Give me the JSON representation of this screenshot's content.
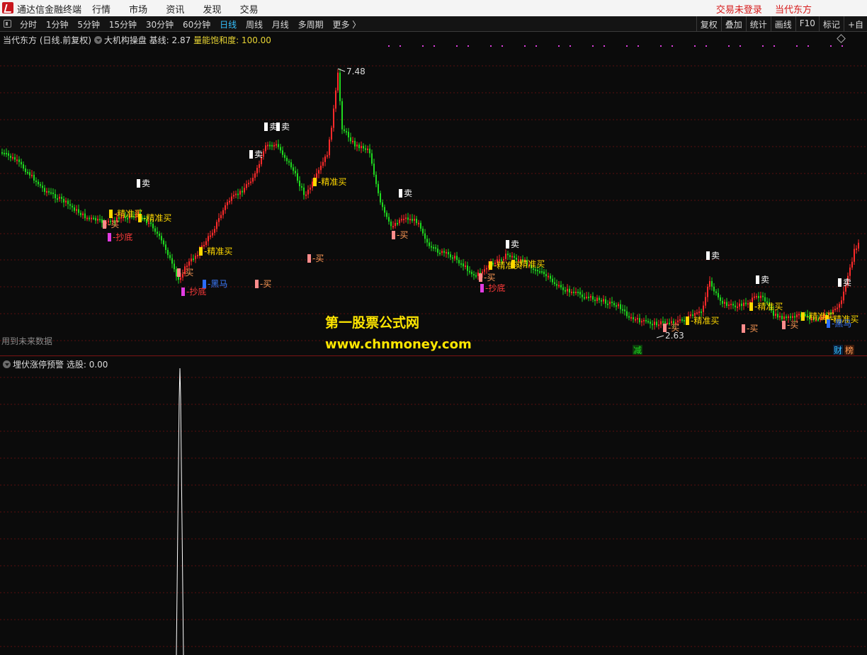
{
  "titlebar": {
    "app_title": "通达信金融终端",
    "menu": [
      "行情",
      "市场",
      "资讯",
      "发现",
      "交易"
    ],
    "trade_status": "交易未登录",
    "stock_name": "当代东方"
  },
  "toolbar": {
    "periods": [
      "分时",
      "1分钟",
      "5分钟",
      "15分钟",
      "30分钟",
      "60分钟",
      "日线",
      "周线",
      "月线",
      "多周期",
      "更多 〉"
    ],
    "active_period": "日线",
    "tools": [
      "复权",
      "叠加",
      "统计",
      "画线",
      "F10",
      "标记",
      "+自"
    ]
  },
  "main_panel": {
    "title": "当代东方 (日线.前复权)",
    "indicator_name": "大机构操盘",
    "baseline": "基线: 2.87",
    "saturation": "量能饱和度: 100.00",
    "high_label": "7.48",
    "low_label": "2.63",
    "future_note": "用到未来数据",
    "corner_tags": [
      "减",
      "财",
      "榜"
    ]
  },
  "watermark": {
    "line1": "第一股票公式网",
    "line2": "www.chnmoney.com"
  },
  "signal_labels": {
    "sell": "卖",
    "buy": "买",
    "precise_buy": "精准买",
    "bottom": "抄底",
    "dark_horse": "黑马"
  },
  "lower_panel": {
    "indicator_name": "埋伏涨停预警",
    "pick": "选股: 0.00"
  },
  "colors": {
    "up": "#ff2a2a",
    "down": "#1fd81f",
    "highlight": "#35c1ff",
    "watermark": "#ffe600",
    "indicator_text": "#e8d534",
    "grid": "#5a0f0f"
  }
}
